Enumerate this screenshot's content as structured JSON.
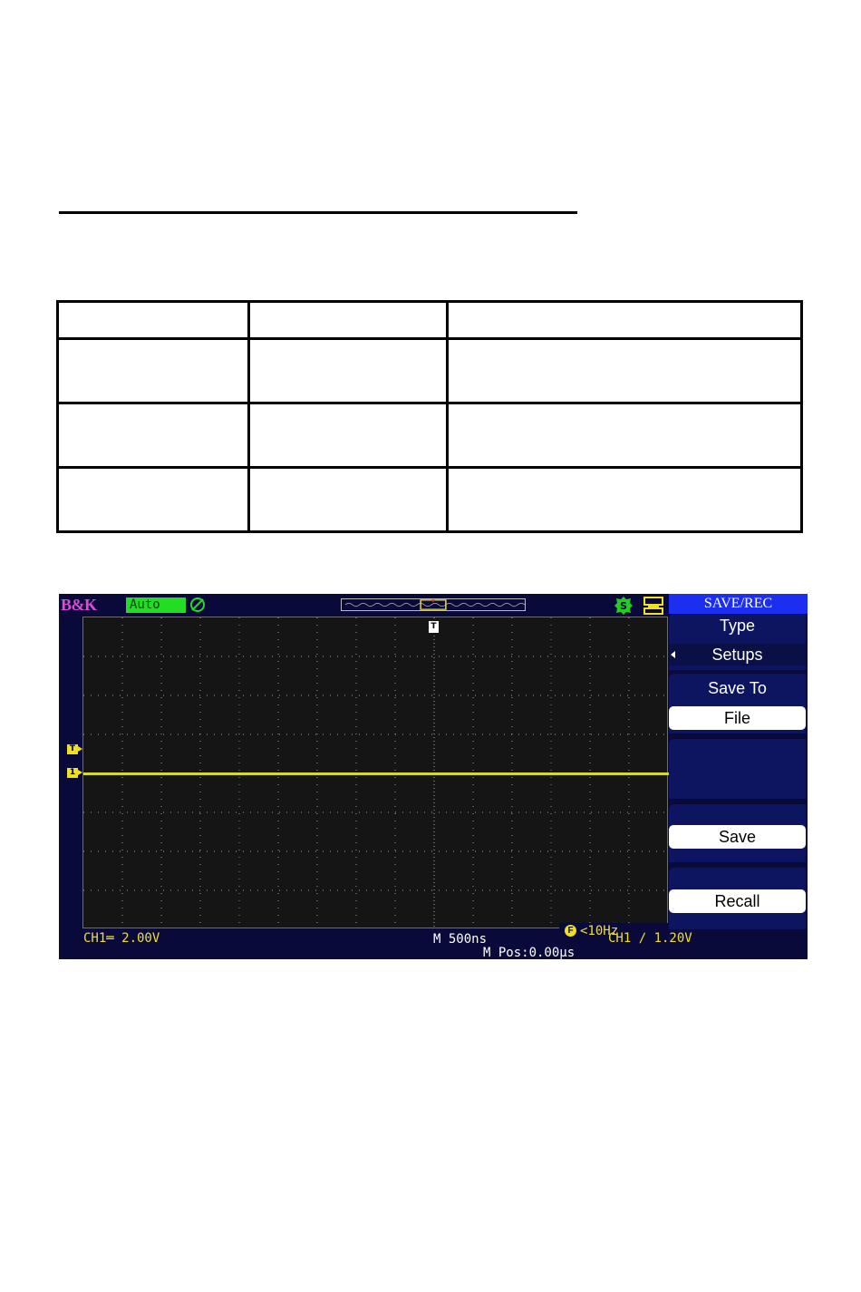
{
  "scope": {
    "brand": "B&K",
    "trigger_mode": "Auto",
    "trigger_marker": "T",
    "channel_marker": "1",
    "frequency": "<10Hz",
    "ch1_scale": "CH1═ 2.00V",
    "timebase": "M 500ns",
    "mpos": "M Pos:0.00µs",
    "trigger_level": "CH1 ∕ 1.20V",
    "colors": {
      "trace": "#d8d82a",
      "screen_bg": "#0a0a3a",
      "title_bar": "#1c2ef0"
    },
    "icons": [
      "trigger-status-icon",
      "s-status-icon",
      "usb-storage-icon"
    ]
  },
  "side_menu": {
    "title": "SAVE/REC",
    "type_label": "Type",
    "type_value": "Setups",
    "save_to_label": "Save To",
    "save_to_value": "File",
    "save_button": "Save",
    "recall_button": "Recall"
  }
}
